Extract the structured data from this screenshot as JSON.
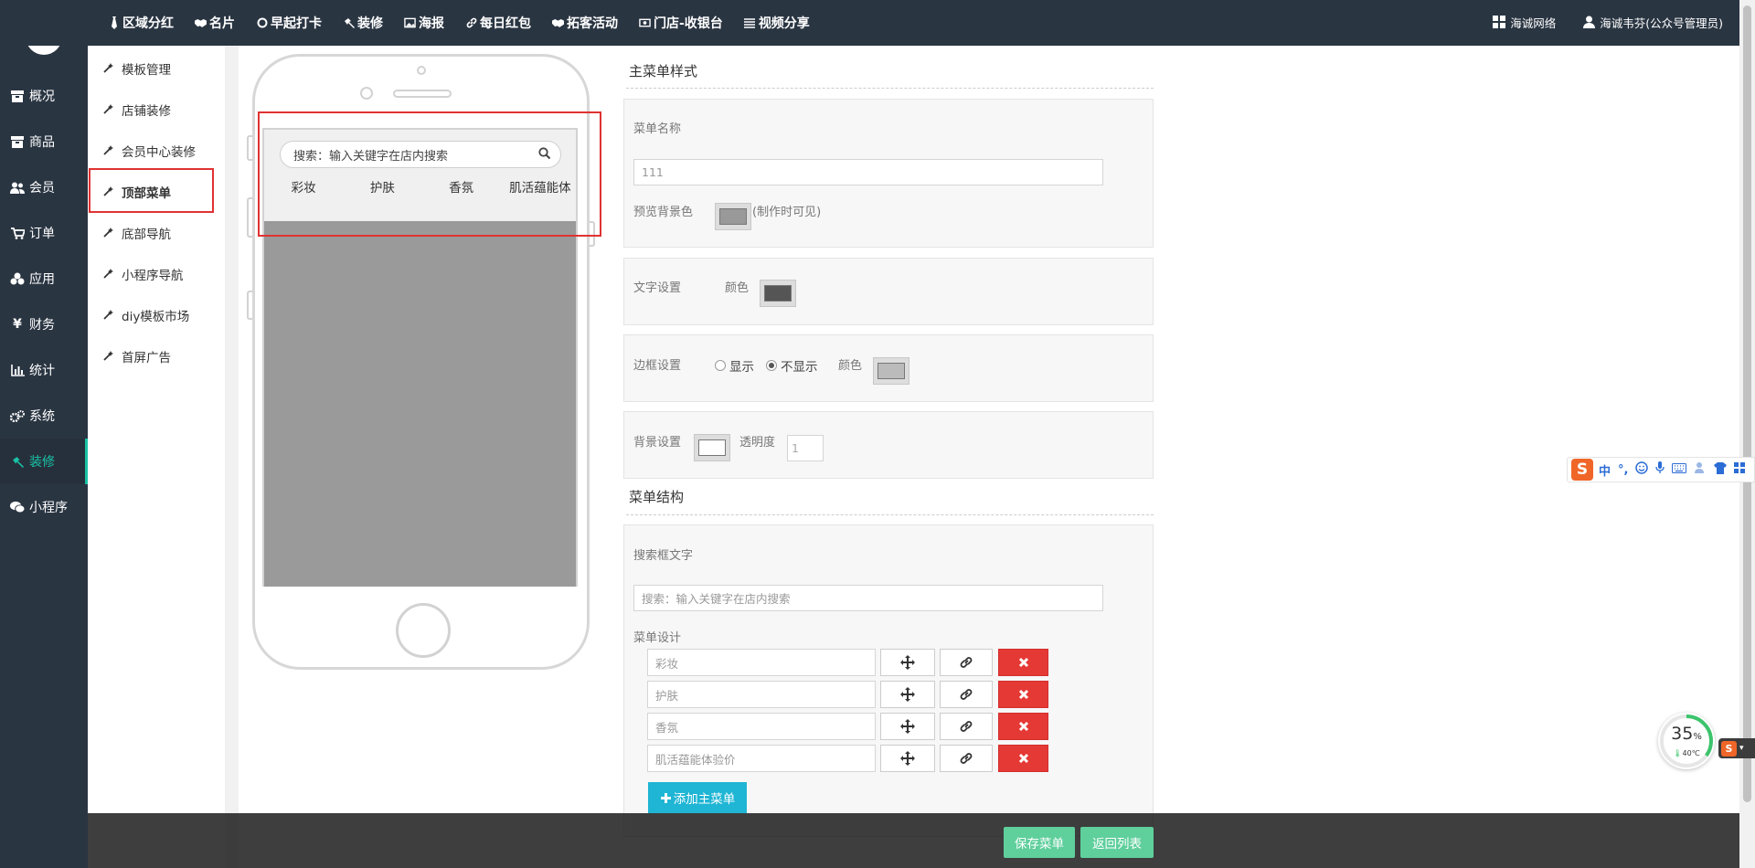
{
  "topnav": [
    {
      "icon": "tie-icon",
      "label": "区域分红"
    },
    {
      "icon": "handshake-icon",
      "label": "名片"
    },
    {
      "icon": "circle-icon",
      "label": "早起打卡"
    },
    {
      "icon": "hammer-icon",
      "label": "装修"
    },
    {
      "icon": "image-icon",
      "label": "海报"
    },
    {
      "icon": "link-icon",
      "label": "每日红包"
    },
    {
      "icon": "handshake-icon",
      "label": "拓客活动"
    },
    {
      "icon": "cash-register-icon",
      "label": "门店-收银台"
    },
    {
      "icon": "list-icon",
      "label": "视频分享"
    }
  ],
  "topright": {
    "company": "海诚网络",
    "user": "海诚韦芬(公众号管理员)"
  },
  "leftnav": [
    {
      "icon": "box-icon",
      "label": "概况"
    },
    {
      "icon": "box-icon",
      "label": "商品"
    },
    {
      "icon": "users-icon",
      "label": "会员"
    },
    {
      "icon": "cart-icon",
      "label": "订单"
    },
    {
      "icon": "apps-icon",
      "label": "应用"
    },
    {
      "icon": "yen-icon",
      "label": "财务"
    },
    {
      "icon": "bar-chart-icon",
      "label": "统计"
    },
    {
      "icon": "gears-icon",
      "label": "系统"
    },
    {
      "icon": "hammer-icon",
      "label": "装修"
    },
    {
      "icon": "wechat-icon",
      "label": "小程序"
    }
  ],
  "subnav": [
    "模板管理",
    "店铺装修",
    "会员中心装修",
    "顶部菜单",
    "底部导航",
    "小程序导航",
    "diy模板市场",
    "首屏广告"
  ],
  "preview": {
    "search_text": "搜索：输入关键字在店内搜索",
    "menus": [
      "彩妆",
      "护肤",
      "香氛",
      "肌活蕴能体"
    ]
  },
  "style_section": {
    "title": "主菜单样式",
    "menu_name_label": "菜单名称",
    "menu_name_value": "111",
    "preview_bg_label": "预览背景色",
    "preview_bg_note": "(制作时可见)",
    "preview_bg_color": "#999999",
    "text_label": "文字设置",
    "text_color_label": "颜色",
    "text_color": "#555555",
    "border_label": "边框设置",
    "border_show": "显示",
    "border_hide": "不显示",
    "border_color_label": "颜色",
    "border_color": "#bbbbbb",
    "bg_label": "背景设置",
    "bg_color": "#ffffff",
    "opacity_label": "透明度",
    "opacity_value": "1"
  },
  "structure_section": {
    "title": "菜单结构",
    "search_label": "搜索框文字",
    "search_value": "搜索：输入关键字在店内搜索",
    "design_label": "菜单设计",
    "items": [
      "彩妆",
      "护肤",
      "香氛",
      "肌活蕴能体验价"
    ],
    "add_label": "添加主菜单"
  },
  "footer": {
    "save": "保存菜单",
    "back": "返回列表"
  },
  "widgets": {
    "ime_logo": "S",
    "ime_lang": "中",
    "gauge_pct": "35",
    "gauge_unit": "%",
    "gauge_temp": "40℃"
  },
  "colors": {
    "sidebar_bg": "#2a3542",
    "accent": "#19c2a5",
    "add_button": "#1fb5d4",
    "footer_button": "#5fcf9c",
    "delete_button": "#e53935"
  }
}
